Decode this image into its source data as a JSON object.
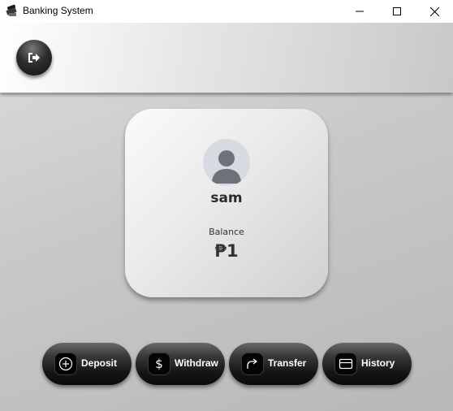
{
  "window": {
    "title": "Banking System",
    "icon": "bank-app-icon",
    "controls": [
      "minimize",
      "maximize",
      "close"
    ]
  },
  "header": {
    "logout_icon": "logout-icon"
  },
  "profile": {
    "avatar_icon": "user-avatar-icon",
    "username": "sam",
    "balance_label": "Balance",
    "balance_value": "₱1"
  },
  "actions": [
    {
      "label": "Deposit",
      "icon": "plus-circle-icon"
    },
    {
      "label": "Withdraw",
      "icon": "dollar-icon"
    },
    {
      "label": "Transfer",
      "icon": "arrow-up-right-icon"
    },
    {
      "label": "History",
      "icon": "card-icon"
    }
  ],
  "colors": {
    "button_dark": "#0a0a0a",
    "background_light": "#dcdcdc",
    "text_dark": "#2b2b2b"
  }
}
